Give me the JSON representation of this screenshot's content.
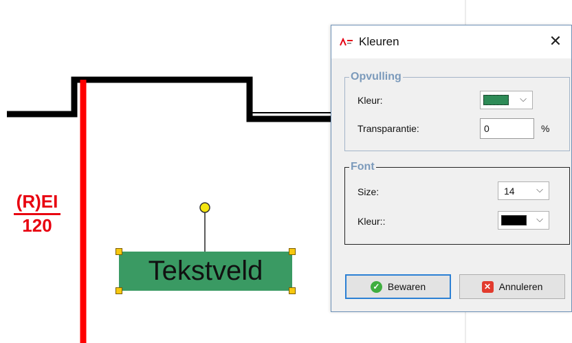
{
  "drawing": {
    "fire_rating_top": "(R)EI",
    "fire_rating_bottom": "120",
    "textbox_text": "Tekstveld",
    "textbox_color": "#3a9a63"
  },
  "dialog": {
    "title": "Kleuren",
    "close_symbol": "✕",
    "fill_group": {
      "legend": "Opvulling",
      "color_label": "Kleur:",
      "color_value": "#2e8b57",
      "transparency_label": "Transparantie:",
      "transparency_value": "0",
      "transparency_unit": "%"
    },
    "font_group": {
      "legend": "Font",
      "size_label": "Size:",
      "size_value": "14",
      "color_label": "Kleur::",
      "color_value": "#000000"
    },
    "buttons": {
      "save_label": "Bewaren",
      "cancel_label": "Annuleren"
    }
  }
}
